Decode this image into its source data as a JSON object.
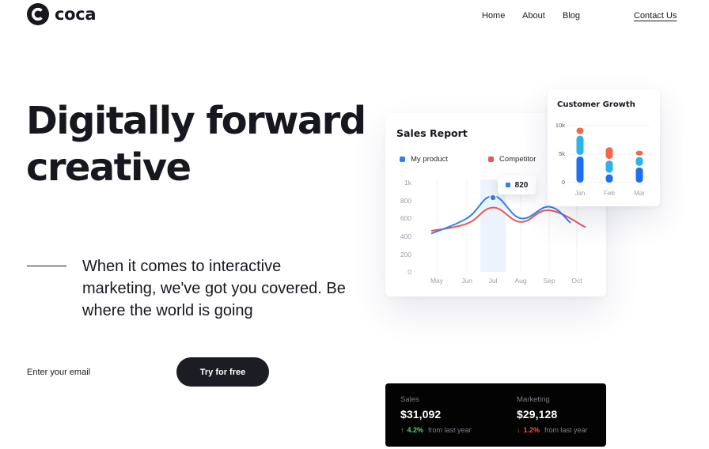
{
  "brand": {
    "name": "coca",
    "icon": "c-logo-icon"
  },
  "nav": {
    "home": "Home",
    "about": "About",
    "blog": "Blog",
    "contact": "Contact Us"
  },
  "hero": {
    "title_line1": "Digitally forward",
    "title_line2": "creative",
    "subtitle": "When it comes to interactive marketing, we've got you covered. Be where the world is going",
    "email_placeholder": "Enter your email",
    "cta_label": "Try for free"
  },
  "sales_report": {
    "title": "Sales Report",
    "tooltip_value": "820",
    "colors": {
      "my_product": "#2f80ed",
      "competitor": "#eb5757",
      "highlight": "#e8f0fc"
    },
    "chart_data": {
      "type": "line",
      "x": [
        "May",
        "Jun",
        "Jul",
        "Aug",
        "Sep",
        "Oct"
      ],
      "y_ticks": [
        "1k",
        "800",
        "600",
        "400",
        "200",
        "0"
      ],
      "ylim": [
        0,
        1000
      ],
      "highlight_category": "Jul",
      "series": [
        {
          "name": "My product",
          "values": [
            430,
            600,
            850,
            600,
            730,
            550
          ]
        },
        {
          "name": "Competitor",
          "values": [
            460,
            540,
            720,
            560,
            690,
            500
          ]
        }
      ]
    }
  },
  "customer_growth": {
    "title": "Customer Growth",
    "colors": {
      "segment1": "#1e6ff0",
      "segment2": "#2bb3ea",
      "segment3": "#f2694a"
    },
    "chart_data": {
      "type": "bar",
      "categories": [
        "Jan",
        "Feb",
        "Mar"
      ],
      "y_ticks": [
        "10k",
        "5k",
        "0"
      ],
      "ylim": [
        0,
        10000
      ],
      "series": [
        {
          "values": [
            4800,
            1700,
            2900
          ]
        },
        {
          "values": [
            3600,
            2400,
            1800
          ]
        },
        {
          "values": [
            1400,
            2300,
            1100
          ]
        }
      ]
    }
  },
  "stats": {
    "sales": {
      "label": "Sales",
      "value": "$31,092",
      "change": "4.2%",
      "note": "from last year",
      "trend": "up",
      "arrow": "↑",
      "color": "#4ed17c"
    },
    "marketing": {
      "label": "Marketing",
      "value": "$29,128",
      "change": "1.2%",
      "note": "from last year",
      "trend": "down",
      "arrow": "↓",
      "color": "#ff4a4a"
    }
  }
}
